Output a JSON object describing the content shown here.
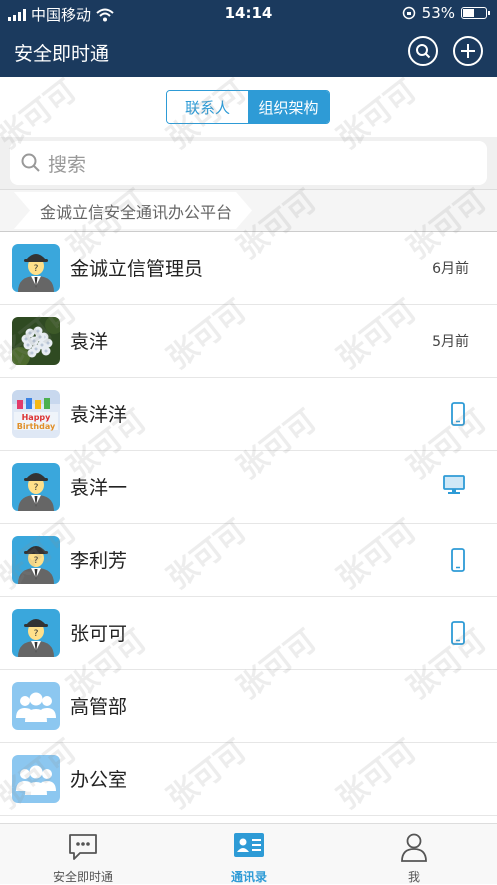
{
  "status_bar": {
    "carrier": "中国移动",
    "time": "14:14",
    "battery": "53%",
    "battery_level": 0.53
  },
  "header": {
    "title": "安全即时通",
    "search_icon": "search-icon",
    "add_icon": "plus-icon"
  },
  "segmented": {
    "contacts": "联系人",
    "org": "组织架构",
    "active": "org"
  },
  "search": {
    "placeholder": "搜索"
  },
  "breadcrumb": "金诚立信安全通讯办公平台",
  "items": [
    {
      "name": "金诚立信管理员",
      "meta": "6月前",
      "avatar": "default-user",
      "device": ""
    },
    {
      "name": "袁洋",
      "meta": "5月前",
      "avatar": "flower-photo",
      "device": ""
    },
    {
      "name": "袁洋洋",
      "meta": "",
      "avatar": "birthday-photo",
      "device": "phone"
    },
    {
      "name": "袁洋一",
      "meta": "",
      "avatar": "default-user",
      "device": "desktop"
    },
    {
      "name": "李利芳",
      "meta": "",
      "avatar": "default-user",
      "device": "phone"
    },
    {
      "name": "张可可",
      "meta": "",
      "avatar": "default-user",
      "device": "phone"
    },
    {
      "name": "高管部",
      "meta": "",
      "avatar": "group",
      "device": ""
    },
    {
      "name": "办公室",
      "meta": "",
      "avatar": "group",
      "device": ""
    }
  ],
  "tabs": [
    {
      "label": "安全即时通",
      "icon": "chat-icon",
      "active": false
    },
    {
      "label": "通讯录",
      "icon": "contacts-icon",
      "active": true
    },
    {
      "label": "我",
      "icon": "person-icon",
      "active": false
    }
  ],
  "watermark": "张可可",
  "colors": {
    "header": "#1b3a5e",
    "accent": "#2e9bd6",
    "avatar_bg": "#3aa7dc",
    "group_bg": "#8cc7f0"
  }
}
